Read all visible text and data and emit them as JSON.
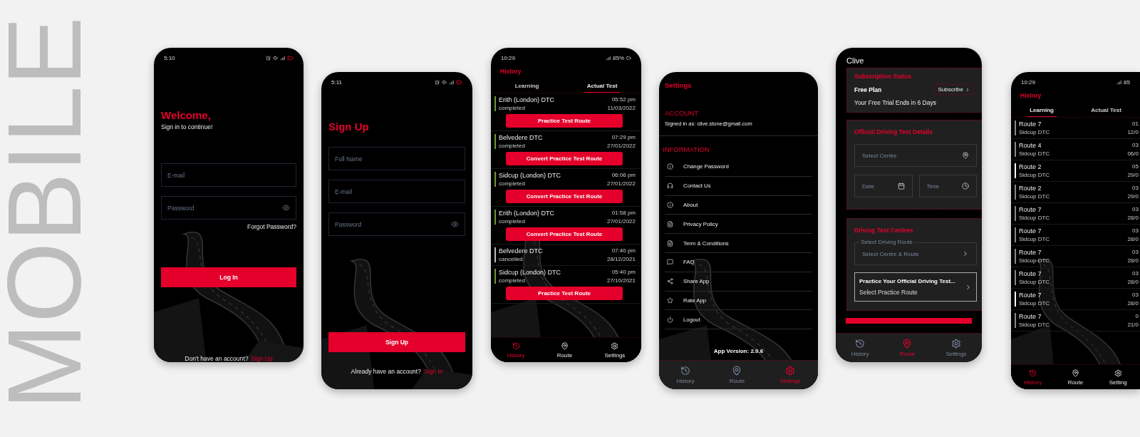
{
  "backdrop_title": "MOBILE",
  "screens": [
    {
      "kind": "login",
      "status_bar": {
        "time": "5:10"
      },
      "title": "Welcome,",
      "subtitle": "Sign in to continue!",
      "fields": [
        {
          "kind": "text",
          "placeholder": "E-mail"
        },
        {
          "kind": "password",
          "placeholder": "Password"
        }
      ],
      "forgot_link": "Forgot Password?",
      "submit": "Log In",
      "footer": {
        "prompt": "Don't have an account?",
        "link": "Sign Up"
      }
    },
    {
      "kind": "signup",
      "status_bar": {
        "time": "5:11"
      },
      "title": "Sign Up",
      "fields": [
        {
          "kind": "text",
          "placeholder": "Full Name"
        },
        {
          "kind": "text",
          "placeholder": "E-mail"
        },
        {
          "kind": "password",
          "placeholder": "Password"
        }
      ],
      "submit": "Sign Up",
      "footer": {
        "prompt": "Already have an account?",
        "link": "Sign In"
      }
    },
    {
      "kind": "history",
      "status_bar": {
        "time": "10:29",
        "battery": "85%"
      },
      "title": "History",
      "tabs": [
        {
          "label": "Learning",
          "selected": false
        },
        {
          "label": "Actual Test",
          "selected": true
        }
      ],
      "entries": [
        {
          "name": "Erith (London) DTC",
          "status": "completed",
          "time": "05:52 pm",
          "date": "11/03/2022",
          "action": "Practice Test Route",
          "color": "#6a9a2e"
        },
        {
          "name": "Belvedere DTC",
          "status": "completed",
          "time": "07:29 pm",
          "date": "27/01/2022",
          "action": "Convert Practice Test Route",
          "color": "#6a9a2e"
        },
        {
          "name": "Sidcup (London) DTC",
          "status": "completed",
          "time": "06:06 pm",
          "date": "27/01/2022",
          "action": "Convert Practice Test Route",
          "color": "#6a9a2e"
        },
        {
          "name": "Erith (London) DTC",
          "status": "completed",
          "time": "01:58 pm",
          "date": "27/01/2022",
          "action": "Convert Practice Test Route",
          "color": "#6a9a2e"
        },
        {
          "name": "Belvedere DTC",
          "status": "cancelled",
          "time": "07:40 pm",
          "date": "28/12/2021",
          "color": "#bbbbbb"
        },
        {
          "name": "Sidcup (London) DTC",
          "status": "completed",
          "time": "05:40 pm",
          "date": "27/10/2021",
          "action": "Practice Test Route",
          "color": "#6a9a2e"
        }
      ],
      "nav": [
        {
          "kind": "history",
          "label": "History",
          "selected": true
        },
        {
          "kind": "route",
          "label": "Route",
          "selected": false
        },
        {
          "kind": "settings",
          "label": "Settings",
          "selected": false
        }
      ]
    },
    {
      "kind": "settings",
      "title": "Settings",
      "account_heading": "ACCOUNT",
      "signed_in": "Signed in as: clive.stone@gmail.com",
      "information_heading": "INFORMATION",
      "items": [
        {
          "kind": "info",
          "label": "Change Password"
        },
        {
          "kind": "contact",
          "label": "Contact Us"
        },
        {
          "kind": "info",
          "label": "About"
        },
        {
          "kind": "document",
          "label": "Privacy Policy"
        },
        {
          "kind": "document",
          "label": "Term & Conditions"
        },
        {
          "kind": "faq",
          "label": "FAQ"
        },
        {
          "kind": "share",
          "label": "Share App"
        },
        {
          "kind": "rate",
          "label": "Rate App"
        },
        {
          "kind": "logout",
          "label": "Logout"
        }
      ],
      "app_version": "App Version: 2.0.6",
      "nav": [
        {
          "kind": "history",
          "label": "History",
          "selected": false
        },
        {
          "kind": "route",
          "label": "Route",
          "selected": false
        },
        {
          "kind": "settings",
          "label": "Settings",
          "selected": true
        }
      ]
    },
    {
      "kind": "route",
      "user": "Clive",
      "subscription": {
        "heading": "Subscription Status",
        "plan": "Free Plan",
        "button": "Subscribe",
        "note": "Your Free Trial Ends in 6 Days"
      },
      "test_details": {
        "heading": "Official Driving Test Details",
        "centre_placeholder": "Select Centre",
        "date_placeholder": "Date",
        "time_placeholder": "Time"
      },
      "centres": {
        "heading": "Driving Test Centres",
        "route_label": "Select Driving Route",
        "route_placeholder": "Select Centre & Route",
        "practice_title": "Practice Your Official Driving Test...",
        "practice_subtitle": "Select Practice Route"
      },
      "nav": [
        {
          "kind": "history",
          "label": "History",
          "selected": false
        },
        {
          "kind": "route",
          "label": "Route",
          "selected": true
        },
        {
          "kind": "settings",
          "label": "Settings",
          "selected": false
        }
      ]
    },
    {
      "kind": "history",
      "status_bar": {
        "time": "10:29",
        "battery": "85"
      },
      "title": "History",
      "tabs": [
        {
          "label": "Learning",
          "selected": true
        },
        {
          "label": "Actual Test",
          "selected": false
        }
      ],
      "entries": [
        {
          "name": "Route 7",
          "status": "Sidcup DTC",
          "time": "01",
          "date": "12/0",
          "color": "#888888"
        },
        {
          "name": "Route 4",
          "status": "Sidcup DTC",
          "time": "03",
          "date": "06/0",
          "color": "#888888"
        },
        {
          "name": "Route 2",
          "status": "Sidcup DTC",
          "time": "05",
          "date": "29/0",
          "color": "#ffffff"
        },
        {
          "name": "Route 2",
          "status": "Sidcup DTC",
          "time": "03",
          "date": "29/0",
          "color": "#888888"
        },
        {
          "name": "Route 7",
          "status": "Sidcup DTC",
          "time": "03",
          "date": "28/0",
          "color": "#888888"
        },
        {
          "name": "Route 7",
          "status": "Sidcup DTC",
          "time": "03",
          "date": "28/0",
          "color": "#888888"
        },
        {
          "name": "Route 7",
          "status": "Sidcup DTC",
          "time": "03",
          "date": "28/0",
          "color": "#888888"
        },
        {
          "name": "Route 7",
          "status": "Sidcup DTC",
          "time": "03",
          "date": "28/0",
          "color": "#888888"
        },
        {
          "name": "Route 7",
          "status": "Sidcup DTC",
          "time": "03",
          "date": "28/0",
          "color": "#ffffff"
        },
        {
          "name": "Route 7",
          "status": "Sidcup DTC",
          "time": "0",
          "date": "21/0",
          "color": "#888888"
        }
      ],
      "nav": [
        {
          "kind": "history",
          "label": "History",
          "selected": true
        },
        {
          "kind": "route",
          "label": "Route",
          "selected": false
        },
        {
          "kind": "settings",
          "label": "Setting",
          "selected": false
        }
      ]
    }
  ]
}
